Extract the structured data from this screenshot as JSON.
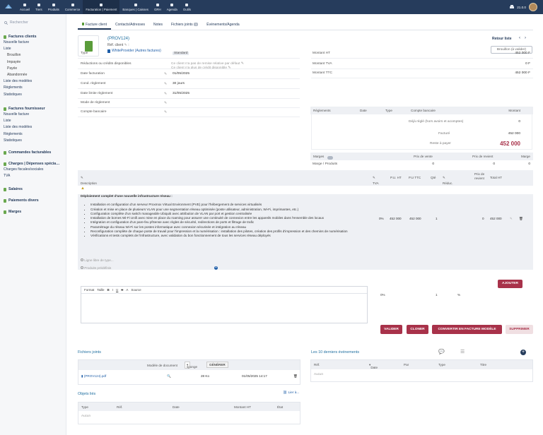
{
  "topbar": {
    "nav": [
      {
        "icon": "home-icon",
        "label": "Accueil"
      },
      {
        "icon": "users-icon",
        "label": "Tiers"
      },
      {
        "icon": "cube-icon",
        "label": "Produits"
      },
      {
        "icon": "basket-icon",
        "label": "Commerce"
      },
      {
        "icon": "invoice-icon",
        "label": "Facturation | Paiement"
      },
      {
        "icon": "bank-icon",
        "label": "Banques | Caisses"
      },
      {
        "icon": "hr-icon",
        "label": "GRH"
      },
      {
        "icon": "calendar-icon",
        "label": "Agenda"
      },
      {
        "icon": "tools-icon",
        "label": "Outils"
      }
    ],
    "version": "21.0.0"
  },
  "sidebar": {
    "search_placeholder": "Rechercher",
    "groups": [
      {
        "title": "Factures clients",
        "items": [
          {
            "label": "Nouvelle facture",
            "sub": false
          },
          {
            "label": "Liste",
            "sub": false
          },
          {
            "label": "Brouillon",
            "sub": true
          },
          {
            "label": "Impayée",
            "sub": true
          },
          {
            "label": "Payée",
            "sub": true
          },
          {
            "label": "Abandonnée",
            "sub": true
          },
          {
            "label": "Liste des modèles",
            "sub": false
          },
          {
            "label": "Règlements",
            "sub": false
          },
          {
            "label": "Statistiques",
            "sub": false
          }
        ]
      },
      {
        "title": "Factures fournisseur",
        "items": [
          {
            "label": "Nouvelle facture",
            "sub": false
          },
          {
            "label": "Liste",
            "sub": false
          },
          {
            "label": "Liste des modèles",
            "sub": false
          },
          {
            "label": "Règlements",
            "sub": false
          },
          {
            "label": "Statistiques",
            "sub": false
          }
        ]
      },
      {
        "title": "Commandes facturables",
        "items": []
      },
      {
        "title": "Charges | Dépenses spécia…",
        "items": [
          {
            "label": "Charges fiscales/sociales",
            "sub": false
          },
          {
            "label": "TVA",
            "sub": false
          }
        ]
      },
      {
        "title": "Salaires",
        "items": []
      },
      {
        "title": "Paiements divers",
        "items": []
      },
      {
        "title": "Marges",
        "items": []
      }
    ]
  },
  "tabs": [
    {
      "label": "Facture client",
      "count": null
    },
    {
      "label": "Contacts/Adresses",
      "count": null
    },
    {
      "label": "Notes",
      "count": null
    },
    {
      "label": "Fichiers joints",
      "count": "1"
    },
    {
      "label": "Événements/Agenda",
      "count": null
    }
  ],
  "header": {
    "ref": "(PROV124)",
    "ref_client_label": "Réf. client",
    "thirdparty": "WhiteProvider (Autres factures)",
    "back_label": "Retour liste",
    "status": "Brouillon (à valider)"
  },
  "fields": [
    {
      "label": "Type",
      "value": "Standard",
      "badge": true
    },
    {
      "label": "Réductions ou crédits disponibles",
      "value": "Ce client n'a pas de remise relative par défaut",
      "value2": "Ce client n'a plus de crédit disponible"
    },
    {
      "label": "Date facturation",
      "value": "01/05/2025"
    },
    {
      "label": "Cond. règlement",
      "value": "30 jours"
    },
    {
      "label": "Date limite règlement",
      "value": "31/05/2025"
    },
    {
      "label": "Mode de règlement",
      "value": ""
    },
    {
      "label": "Compte bancaire",
      "value": ""
    }
  ],
  "amounts": [
    {
      "label": "Montant HT",
      "value": "452 000 F"
    },
    {
      "label": "Montant TVA",
      "value": "0 F"
    },
    {
      "label": "Montant TTC",
      "value": "452 000 F"
    }
  ],
  "payments": {
    "headers": [
      "Règlements",
      "Date",
      "Type",
      "Compte bancaire",
      "Montant"
    ],
    "already_paid_label": "Déjà réglé (hors avoirs et acomptes)",
    "already_paid": "0",
    "billed_label": "Facturé",
    "billed": "452 000",
    "remaining_label": "Reste à payer",
    "remaining": "452 000"
  },
  "margins": {
    "headers": [
      "Marges",
      "Prix de vente",
      "Prix de revient",
      "Marge"
    ],
    "row_label": "Marge / Produits",
    "sale": "0",
    "cost": "0",
    "margin": "0"
  },
  "lines": {
    "headers": [
      "Description",
      "TVA",
      "P.U. HT",
      "P.U TTC",
      "Qté",
      "Réduc.",
      "Prix de revient",
      "Total HT"
    ],
    "title": "Déploiement complet d'une nouvelle infrastructure réseau :",
    "bullets": [
      "Installation et configuration d'un serveur Proxmox Virtual Environment (PVE) pour l'hébergement de services virtualisés",
      "Création et mise en place de plusieurs VLAN pour une segmentation réseau optimisée (poste utilisateur, administration, Wi-Fi, imprimantes, etc.)",
      "Configuration complète d'un switch manageable Ubiquiti avec attribution de VLAN par port et gestion centralisée",
      "Installation de bornes Wi-Fi Unifi avec mise en place du roaming pour assurer une continuité de connexion entre les appareils mobiles dans l'ensemble des locaux",
      "Intégration et configuration d'un pare-feu pfSense avec règles de sécurité, redirections de ports et filtrage de trafic",
      "Paramétrage du réseau Wi-Fi sur les postes informatique avec connexion sécurisée et intégration au réseau",
      "Reconfiguration complète de chaque poste de travail pour l'impression et la numérisation : installation des pilotes, création des profils d'impression et des chemins de numérisation",
      "Vérifications et tests complets de l'infrastructure, avec validation du bon fonctionnement de tous les services réseau déployés"
    ],
    "tva": "0%",
    "pu_ht": "452 000",
    "pu_ttc": "452 000",
    "qty": "1",
    "cost": "0",
    "total": "452 000",
    "free_line_placeholder": "Ligne libre de type...",
    "product_placeholder": "Produits prédéfinis",
    "editor_toolbar": [
      "Format",
      "Taille",
      "B",
      "I",
      "U",
      "S",
      "A",
      "Source"
    ],
    "new_tva": "0%",
    "new_qty": "1",
    "new_pct": "%",
    "add_button": "AJOUTER"
  },
  "actions": {
    "validate": "VALIDER",
    "clone": "CLONER",
    "convert": "CONVERTIR EN FACTURE MODÈLE",
    "delete": "SUPPRIMER"
  },
  "files": {
    "title": "Fichiers joints",
    "model_label": "Modèle de document",
    "model_value": "sponge",
    "generate": "GÉNÉRER",
    "file_name": "(PROV124).pdf",
    "file_size": "28 Ko",
    "file_date": "01/05/2025 14:17"
  },
  "linked": {
    "title": "Objets liés",
    "link_label": "Lier à...",
    "headers": [
      "Type",
      "Réf.",
      "Date",
      "Montant HT",
      "État"
    ],
    "empty": "Aucun"
  },
  "events": {
    "title": "Les 10 derniers événements",
    "headers": [
      "Réf.",
      "Date",
      "Par",
      "Type",
      "Titre"
    ],
    "empty": "Aucun"
  },
  "colors": {
    "topbar": "#263c5c",
    "accent": "#a8324a",
    "link": "#1f6fa0"
  }
}
